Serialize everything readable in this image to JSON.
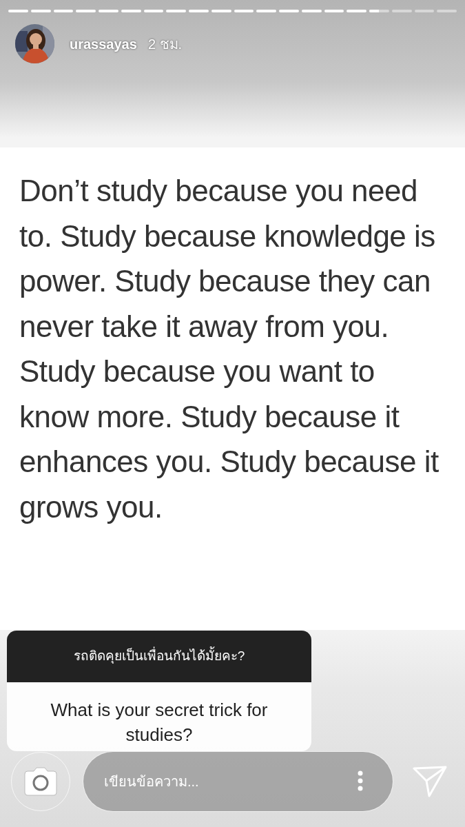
{
  "progress": [
    {
      "level": 1
    },
    {
      "level": 1
    },
    {
      "level": 1
    },
    {
      "level": 1
    },
    {
      "level": 1
    },
    {
      "level": 1
    },
    {
      "level": 1
    },
    {
      "level": 1
    },
    {
      "level": 1
    },
    {
      "level": 1
    },
    {
      "level": 1
    },
    {
      "level": 1
    },
    {
      "level": 1
    },
    {
      "level": 1
    },
    {
      "level": 1
    },
    {
      "level": 1
    },
    {
      "level": 0.5
    },
    {
      "level": 0
    },
    {
      "level": 0
    },
    {
      "level": 0
    }
  ],
  "story_header": {
    "username": "urassayas",
    "time": "2 ชม."
  },
  "quote": "Don’t study because you need to. Study because knowledge is power. Study because they can never take it away from you. Study because you want to know more. Study because it enhances you. Study because it grows you.",
  "question_sticker": {
    "title": "รถติดคุยเป็นเพื่อนกันได้มั้ยคะ?",
    "question": "What is your secret trick for studies?"
  },
  "reply_bar": {
    "placeholder": "เขียนข้อความ..."
  }
}
